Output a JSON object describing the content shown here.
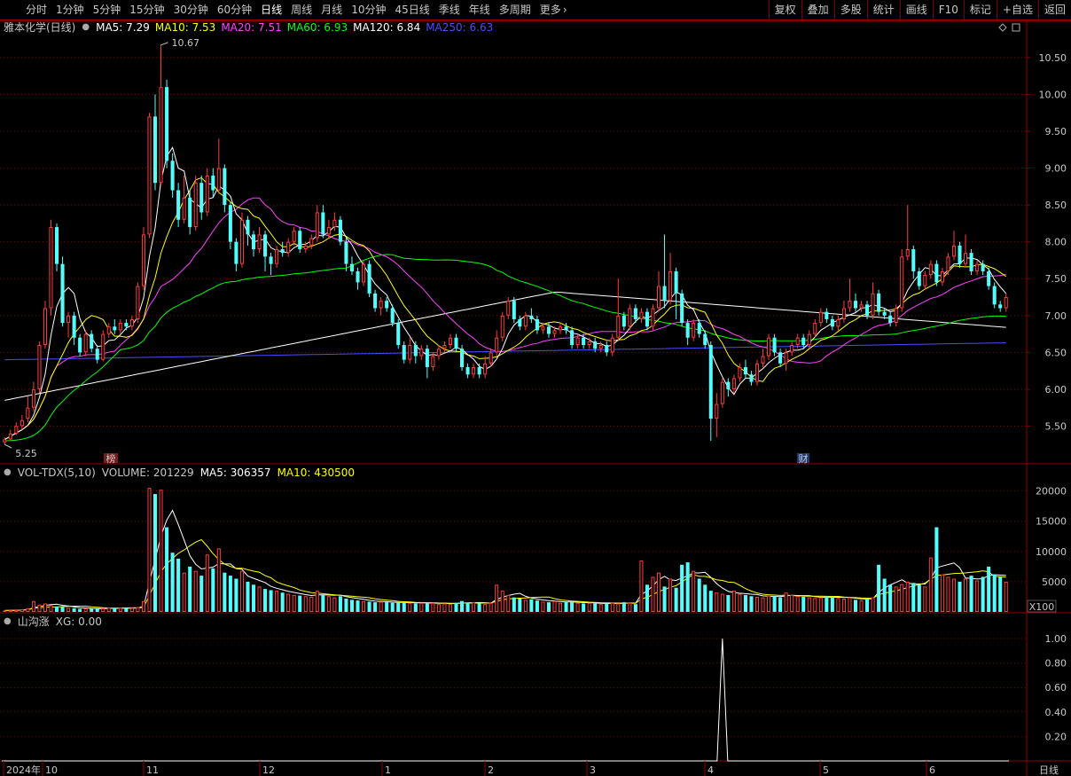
{
  "toolbar": {
    "periods": [
      "分时",
      "1分钟",
      "5分钟",
      "15分钟",
      "30分钟",
      "60分钟",
      "日线",
      "周线",
      "月线",
      "10分钟",
      "45日线",
      "季线",
      "年线",
      "多周期",
      "更多"
    ],
    "active_period": "日线",
    "more_chevron": "›",
    "actions": [
      "复权",
      "叠加",
      "多股",
      "统计",
      "画线",
      "F10",
      "标记",
      "+自选",
      "返回"
    ]
  },
  "price_panel": {
    "stock_name": "雅本化学(日线)",
    "indicators": [
      {
        "label": "MA5: 7.29",
        "color": "#ffffff"
      },
      {
        "label": "MA10: 7.53",
        "color": "#ffff00"
      },
      {
        "label": "MA20: 7.51",
        "color": "#ff40ff"
      },
      {
        "label": "MA60: 6.93",
        "color": "#00ff00"
      },
      {
        "label": "MA120: 6.84",
        "color": "#ffffff"
      },
      {
        "label": "MA250: 6.63",
        "color": "#4b4bff"
      }
    ],
    "high_label": "10.67",
    "low_label": "5.25",
    "y_ticks": [
      "10.50",
      "10.00",
      "9.50",
      "9.00",
      "8.50",
      "8.00",
      "7.50",
      "7.00",
      "6.50",
      "6.00",
      "5.50"
    ],
    "marker_bang": "榜",
    "marker_cai": "财"
  },
  "volume_panel": {
    "title": "VOL-TDX(5,10)",
    "volume": "VOLUME: 201229",
    "ma5": "MA5: 306357",
    "ma10": "MA10: 430500",
    "y_ticks": [
      "20000",
      "15000",
      "10000",
      "5000"
    ],
    "unit": "X100"
  },
  "indicator_panel": {
    "title": "山沟涨",
    "value": "XG: 0.00",
    "y_ticks": [
      "1.00",
      "0.80",
      "0.60",
      "0.40",
      "0.20"
    ]
  },
  "x_axis": {
    "labels": [
      "2024年",
      "10",
      "11",
      "12",
      "1",
      "2",
      "3",
      "4",
      "5",
      "6"
    ],
    "period": "日线"
  },
  "colors": {
    "up": "#ff3c3c",
    "down": "#54fcfc",
    "grid": "#8b0000",
    "ma5": "#ffffff",
    "ma10": "#ffff00",
    "ma20": "#ff40ff",
    "ma60": "#00ff00",
    "ma120": "#ffffff",
    "ma250": "#4b4bff"
  },
  "chart_data": {
    "type": "candlestick",
    "title": "雅本化学(日线)",
    "price_range": [
      5.0,
      10.8
    ],
    "high": 10.67,
    "low": 5.25,
    "candles": [
      {
        "o": 5.28,
        "c": 5.32,
        "h": 5.35,
        "l": 5.25
      },
      {
        "o": 5.32,
        "c": 5.4,
        "h": 5.45,
        "l": 5.3
      },
      {
        "o": 5.4,
        "c": 5.5,
        "h": 5.55,
        "l": 5.38
      },
      {
        "o": 5.5,
        "c": 5.58,
        "h": 5.65,
        "l": 5.45
      },
      {
        "o": 5.6,
        "c": 5.75,
        "h": 5.9,
        "l": 5.55
      },
      {
        "o": 5.75,
        "c": 6.0,
        "h": 6.1,
        "l": 5.7
      },
      {
        "o": 6.0,
        "c": 6.6,
        "h": 6.65,
        "l": 5.95
      },
      {
        "o": 6.6,
        "c": 7.1,
        "h": 7.2,
        "l": 6.55
      },
      {
        "o": 7.1,
        "c": 8.2,
        "h": 8.3,
        "l": 7.0
      },
      {
        "o": 8.2,
        "c": 7.7,
        "h": 8.25,
        "l": 7.6
      },
      {
        "o": 7.7,
        "c": 6.9,
        "h": 7.8,
        "l": 6.85
      },
      {
        "o": 6.9,
        "c": 7.0,
        "h": 7.05,
        "l": 6.7
      },
      {
        "o": 7.0,
        "c": 6.7,
        "h": 7.05,
        "l": 6.6
      },
      {
        "o": 6.7,
        "c": 6.5,
        "h": 6.75,
        "l": 6.45
      },
      {
        "o": 6.5,
        "c": 6.75,
        "h": 6.8,
        "l": 6.45
      },
      {
        "o": 6.75,
        "c": 6.55,
        "h": 6.8,
        "l": 6.5
      },
      {
        "o": 6.55,
        "c": 6.4,
        "h": 6.6,
        "l": 6.35
      },
      {
        "o": 6.4,
        "c": 6.75,
        "h": 6.8,
        "l": 6.38
      },
      {
        "o": 6.75,
        "c": 6.85,
        "h": 6.9,
        "l": 6.7
      },
      {
        "o": 6.85,
        "c": 6.8,
        "h": 6.95,
        "l": 6.75
      },
      {
        "o": 6.8,
        "c": 6.9,
        "h": 6.95,
        "l": 6.75
      },
      {
        "o": 6.9,
        "c": 6.85,
        "h": 6.95,
        "l": 6.8
      },
      {
        "o": 6.85,
        "c": 6.95,
        "h": 7.0,
        "l": 6.8
      },
      {
        "o": 6.95,
        "c": 7.4,
        "h": 7.45,
        "l": 6.9
      },
      {
        "o": 7.4,
        "c": 8.1,
        "h": 8.2,
        "l": 7.35
      },
      {
        "o": 8.1,
        "c": 9.7,
        "h": 9.75,
        "l": 8.05
      },
      {
        "o": 9.7,
        "c": 8.8,
        "h": 10.0,
        "l": 8.7
      },
      {
        "o": 8.8,
        "c": 10.1,
        "h": 10.67,
        "l": 8.75
      },
      {
        "o": 10.1,
        "c": 9.1,
        "h": 10.2,
        "l": 9.0
      },
      {
        "o": 9.1,
        "c": 8.7,
        "h": 9.2,
        "l": 8.6
      },
      {
        "o": 8.7,
        "c": 8.3,
        "h": 8.8,
        "l": 8.2
      },
      {
        "o": 8.3,
        "c": 8.6,
        "h": 8.9,
        "l": 8.25
      },
      {
        "o": 8.6,
        "c": 8.2,
        "h": 8.7,
        "l": 8.1
      },
      {
        "o": 8.2,
        "c": 8.8,
        "h": 8.9,
        "l": 8.15
      },
      {
        "o": 8.8,
        "c": 8.4,
        "h": 8.9,
        "l": 8.3
      },
      {
        "o": 8.4,
        "c": 8.9,
        "h": 9.0,
        "l": 8.35
      },
      {
        "o": 8.9,
        "c": 8.7,
        "h": 9.0,
        "l": 8.6
      },
      {
        "o": 8.7,
        "c": 9.0,
        "h": 9.4,
        "l": 8.65
      },
      {
        "o": 9.0,
        "c": 8.5,
        "h": 9.05,
        "l": 8.4
      },
      {
        "o": 8.5,
        "c": 8.0,
        "h": 8.55,
        "l": 7.9
      },
      {
        "o": 8.0,
        "c": 7.7,
        "h": 8.05,
        "l": 7.6
      },
      {
        "o": 7.7,
        "c": 8.3,
        "h": 8.4,
        "l": 7.65
      },
      {
        "o": 8.3,
        "c": 8.1,
        "h": 8.35,
        "l": 7.95
      },
      {
        "o": 8.1,
        "c": 7.9,
        "h": 8.15,
        "l": 7.8
      },
      {
        "o": 7.9,
        "c": 8.1,
        "h": 8.2,
        "l": 7.85
      },
      {
        "o": 8.1,
        "c": 7.8,
        "h": 8.15,
        "l": 7.6
      },
      {
        "o": 7.8,
        "c": 7.7,
        "h": 7.85,
        "l": 7.55
      },
      {
        "o": 7.7,
        "c": 7.9,
        "h": 7.95,
        "l": 7.65
      },
      {
        "o": 7.9,
        "c": 7.85,
        "h": 8.0,
        "l": 7.8
      },
      {
        "o": 7.85,
        "c": 8.0,
        "h": 8.05,
        "l": 7.8
      },
      {
        "o": 8.0,
        "c": 8.15,
        "h": 8.2,
        "l": 7.95
      },
      {
        "o": 8.15,
        "c": 7.9,
        "h": 8.2,
        "l": 7.85
      },
      {
        "o": 7.9,
        "c": 7.95,
        "h": 8.0,
        "l": 7.85
      },
      {
        "o": 7.95,
        "c": 8.05,
        "h": 8.1,
        "l": 7.9
      },
      {
        "o": 8.05,
        "c": 8.4,
        "h": 8.5,
        "l": 8.0
      },
      {
        "o": 8.4,
        "c": 8.1,
        "h": 8.5,
        "l": 8.05
      },
      {
        "o": 8.1,
        "c": 8.2,
        "h": 8.3,
        "l": 8.05
      },
      {
        "o": 8.2,
        "c": 8.3,
        "h": 8.4,
        "l": 8.15
      },
      {
        "o": 8.3,
        "c": 8.0,
        "h": 8.35,
        "l": 7.95
      },
      {
        "o": 8.0,
        "c": 7.7,
        "h": 8.05,
        "l": 7.6
      },
      {
        "o": 7.7,
        "c": 7.6,
        "h": 7.8,
        "l": 7.55
      },
      {
        "o": 7.6,
        "c": 7.45,
        "h": 7.65,
        "l": 7.35
      },
      {
        "o": 7.45,
        "c": 7.7,
        "h": 7.75,
        "l": 7.4
      },
      {
        "o": 7.7,
        "c": 7.3,
        "h": 7.75,
        "l": 7.25
      },
      {
        "o": 7.3,
        "c": 7.1,
        "h": 7.35,
        "l": 7.05
      },
      {
        "o": 7.1,
        "c": 7.2,
        "h": 7.25,
        "l": 7.0
      },
      {
        "o": 7.2,
        "c": 7.1,
        "h": 7.25,
        "l": 7.05
      },
      {
        "o": 7.1,
        "c": 6.9,
        "h": 7.15,
        "l": 6.85
      },
      {
        "o": 6.9,
        "c": 6.6,
        "h": 6.95,
        "l": 6.55
      },
      {
        "o": 6.6,
        "c": 6.4,
        "h": 6.65,
        "l": 6.35
      },
      {
        "o": 6.4,
        "c": 6.6,
        "h": 6.7,
        "l": 6.35
      },
      {
        "o": 6.6,
        "c": 6.45,
        "h": 6.65,
        "l": 6.35
      },
      {
        "o": 6.45,
        "c": 6.55,
        "h": 6.6,
        "l": 6.4
      },
      {
        "o": 6.55,
        "c": 6.3,
        "h": 6.6,
        "l": 6.15
      },
      {
        "o": 6.3,
        "c": 6.45,
        "h": 6.5,
        "l": 6.25
      },
      {
        "o": 6.45,
        "c": 6.55,
        "h": 6.6,
        "l": 6.4
      },
      {
        "o": 6.55,
        "c": 6.6,
        "h": 6.65,
        "l": 6.5
      },
      {
        "o": 6.6,
        "c": 6.7,
        "h": 6.75,
        "l": 6.55
      },
      {
        "o": 6.7,
        "c": 6.55,
        "h": 6.75,
        "l": 6.5
      },
      {
        "o": 6.55,
        "c": 6.3,
        "h": 6.6,
        "l": 6.25
      },
      {
        "o": 6.3,
        "c": 6.2,
        "h": 6.35,
        "l": 6.15
      },
      {
        "o": 6.2,
        "c": 6.3,
        "h": 6.35,
        "l": 6.15
      },
      {
        "o": 6.3,
        "c": 6.2,
        "h": 6.35,
        "l": 6.15
      },
      {
        "o": 6.2,
        "c": 6.35,
        "h": 6.45,
        "l": 6.15
      },
      {
        "o": 6.35,
        "c": 6.5,
        "h": 6.55,
        "l": 6.3
      },
      {
        "o": 6.5,
        "c": 6.7,
        "h": 6.8,
        "l": 6.45
      },
      {
        "o": 6.7,
        "c": 7.0,
        "h": 7.05,
        "l": 6.65
      },
      {
        "o": 7.0,
        "c": 7.2,
        "h": 7.25,
        "l": 6.95
      },
      {
        "o": 7.2,
        "c": 6.95,
        "h": 7.25,
        "l": 6.9
      },
      {
        "o": 6.95,
        "c": 6.85,
        "h": 7.0,
        "l": 6.8
      },
      {
        "o": 6.85,
        "c": 7.0,
        "h": 7.05,
        "l": 6.8
      },
      {
        "o": 7.0,
        "c": 6.95,
        "h": 7.1,
        "l": 6.9
      },
      {
        "o": 6.95,
        "c": 6.8,
        "h": 7.0,
        "l": 6.75
      },
      {
        "o": 6.8,
        "c": 6.85,
        "h": 6.9,
        "l": 6.75
      },
      {
        "o": 6.85,
        "c": 6.75,
        "h": 6.9,
        "l": 6.7
      },
      {
        "o": 6.75,
        "c": 6.8,
        "h": 6.85,
        "l": 6.7
      },
      {
        "o": 6.8,
        "c": 6.85,
        "h": 6.9,
        "l": 6.75
      },
      {
        "o": 6.85,
        "c": 6.8,
        "h": 6.9,
        "l": 6.75
      },
      {
        "o": 6.8,
        "c": 6.6,
        "h": 6.85,
        "l": 6.55
      },
      {
        "o": 6.6,
        "c": 6.7,
        "h": 6.75,
        "l": 6.55
      },
      {
        "o": 6.7,
        "c": 6.6,
        "h": 6.75,
        "l": 6.55
      },
      {
        "o": 6.6,
        "c": 6.65,
        "h": 6.7,
        "l": 6.55
      },
      {
        "o": 6.65,
        "c": 6.55,
        "h": 6.7,
        "l": 6.5
      },
      {
        "o": 6.55,
        "c": 6.6,
        "h": 6.65,
        "l": 6.5
      },
      {
        "o": 6.6,
        "c": 6.5,
        "h": 6.65,
        "l": 6.45
      },
      {
        "o": 6.5,
        "c": 6.7,
        "h": 6.75,
        "l": 6.45
      },
      {
        "o": 6.7,
        "c": 7.0,
        "h": 7.5,
        "l": 6.65
      },
      {
        "o": 7.0,
        "c": 6.85,
        "h": 7.05,
        "l": 6.8
      },
      {
        "o": 6.85,
        "c": 7.1,
        "h": 7.15,
        "l": 6.8
      },
      {
        "o": 7.1,
        "c": 6.95,
        "h": 7.15,
        "l": 6.9
      },
      {
        "o": 6.95,
        "c": 7.05,
        "h": 7.1,
        "l": 6.9
      },
      {
        "o": 7.05,
        "c": 6.85,
        "h": 7.1,
        "l": 6.8
      },
      {
        "o": 6.85,
        "c": 7.1,
        "h": 7.15,
        "l": 6.8
      },
      {
        "o": 7.1,
        "c": 7.4,
        "h": 7.6,
        "l": 7.05
      },
      {
        "o": 7.4,
        "c": 7.2,
        "h": 8.1,
        "l": 7.1
      },
      {
        "o": 7.2,
        "c": 7.6,
        "h": 7.85,
        "l": 7.15
      },
      {
        "o": 7.6,
        "c": 7.3,
        "h": 7.65,
        "l": 6.95
      },
      {
        "o": 7.3,
        "c": 6.9,
        "h": 7.35,
        "l": 6.85
      },
      {
        "o": 6.9,
        "c": 6.7,
        "h": 6.95,
        "l": 6.6
      },
      {
        "o": 6.7,
        "c": 6.9,
        "h": 6.95,
        "l": 6.65
      },
      {
        "o": 6.9,
        "c": 6.75,
        "h": 6.95,
        "l": 6.7
      },
      {
        "o": 6.75,
        "c": 6.6,
        "h": 6.8,
        "l": 6.55
      },
      {
        "o": 6.6,
        "c": 5.6,
        "h": 6.65,
        "l": 5.3
      },
      {
        "o": 5.6,
        "c": 5.8,
        "h": 5.95,
        "l": 5.35
      },
      {
        "o": 5.8,
        "c": 6.1,
        "h": 6.15,
        "l": 5.75
      },
      {
        "o": 6.1,
        "c": 6.0,
        "h": 6.15,
        "l": 5.9
      },
      {
        "o": 6.0,
        "c": 6.15,
        "h": 6.2,
        "l": 5.95
      },
      {
        "o": 6.15,
        "c": 6.3,
        "h": 6.35,
        "l": 6.1
      },
      {
        "o": 6.3,
        "c": 6.2,
        "h": 6.4,
        "l": 6.15
      },
      {
        "o": 6.2,
        "c": 6.1,
        "h": 6.25,
        "l": 6.05
      },
      {
        "o": 6.1,
        "c": 6.35,
        "h": 6.4,
        "l": 6.05
      },
      {
        "o": 6.35,
        "c": 6.45,
        "h": 6.55,
        "l": 6.3
      },
      {
        "o": 6.45,
        "c": 6.7,
        "h": 6.75,
        "l": 6.4
      },
      {
        "o": 6.7,
        "c": 6.5,
        "h": 6.75,
        "l": 6.45
      },
      {
        "o": 6.5,
        "c": 6.35,
        "h": 6.55,
        "l": 6.3
      },
      {
        "o": 6.35,
        "c": 6.5,
        "h": 6.55,
        "l": 6.25
      },
      {
        "o": 6.5,
        "c": 6.6,
        "h": 6.65,
        "l": 6.45
      },
      {
        "o": 6.6,
        "c": 6.7,
        "h": 6.75,
        "l": 6.55
      },
      {
        "o": 6.7,
        "c": 6.6,
        "h": 6.75,
        "l": 6.55
      },
      {
        "o": 6.6,
        "c": 6.75,
        "h": 6.8,
        "l": 6.55
      },
      {
        "o": 6.75,
        "c": 6.9,
        "h": 6.95,
        "l": 6.7
      },
      {
        "o": 6.9,
        "c": 7.05,
        "h": 7.1,
        "l": 6.85
      },
      {
        "o": 7.05,
        "c": 6.95,
        "h": 7.1,
        "l": 6.9
      },
      {
        "o": 6.95,
        "c": 6.85,
        "h": 7.0,
        "l": 6.8
      },
      {
        "o": 6.85,
        "c": 6.95,
        "h": 7.0,
        "l": 6.8
      },
      {
        "o": 6.95,
        "c": 7.1,
        "h": 7.2,
        "l": 6.9
      },
      {
        "o": 7.1,
        "c": 7.2,
        "h": 7.5,
        "l": 7.05
      },
      {
        "o": 7.2,
        "c": 7.1,
        "h": 7.3,
        "l": 7.05
      },
      {
        "o": 7.1,
        "c": 7.15,
        "h": 7.2,
        "l": 7.05
      },
      {
        "o": 7.15,
        "c": 7.0,
        "h": 7.2,
        "l": 6.95
      },
      {
        "o": 7.0,
        "c": 7.3,
        "h": 7.45,
        "l": 6.95
      },
      {
        "o": 7.3,
        "c": 7.05,
        "h": 7.35,
        "l": 7.0
      },
      {
        "o": 7.05,
        "c": 7.0,
        "h": 7.1,
        "l": 6.95
      },
      {
        "o": 7.0,
        "c": 6.9,
        "h": 7.05,
        "l": 6.85
      },
      {
        "o": 6.9,
        "c": 7.1,
        "h": 7.15,
        "l": 6.85
      },
      {
        "o": 7.1,
        "c": 7.8,
        "h": 7.9,
        "l": 7.05
      },
      {
        "o": 7.8,
        "c": 7.9,
        "h": 8.5,
        "l": 7.75
      },
      {
        "o": 7.9,
        "c": 7.6,
        "h": 7.95,
        "l": 7.5
      },
      {
        "o": 7.6,
        "c": 7.4,
        "h": 7.65,
        "l": 7.35
      },
      {
        "o": 7.4,
        "c": 7.55,
        "h": 7.6,
        "l": 7.35
      },
      {
        "o": 7.55,
        "c": 7.7,
        "h": 7.75,
        "l": 7.5
      },
      {
        "o": 7.7,
        "c": 7.45,
        "h": 7.75,
        "l": 7.4
      },
      {
        "o": 7.45,
        "c": 7.6,
        "h": 7.65,
        "l": 7.4
      },
      {
        "o": 7.6,
        "c": 7.8,
        "h": 7.85,
        "l": 7.55
      },
      {
        "o": 7.8,
        "c": 7.95,
        "h": 8.15,
        "l": 7.75
      },
      {
        "o": 7.95,
        "c": 7.7,
        "h": 8.0,
        "l": 7.65
      },
      {
        "o": 7.7,
        "c": 7.85,
        "h": 8.1,
        "l": 7.65
      },
      {
        "o": 7.85,
        "c": 7.6,
        "h": 7.9,
        "l": 7.55
      },
      {
        "o": 7.6,
        "c": 7.7,
        "h": 7.75,
        "l": 7.55
      },
      {
        "o": 7.7,
        "c": 7.6,
        "h": 7.75,
        "l": 7.55
      },
      {
        "o": 7.6,
        "c": 7.4,
        "h": 7.65,
        "l": 7.35
      },
      {
        "o": 7.4,
        "c": 7.15,
        "h": 7.45,
        "l": 7.1
      },
      {
        "o": 7.15,
        "c": 7.1,
        "h": 7.2,
        "l": 7.05
      },
      {
        "o": 7.1,
        "c": 7.25,
        "h": 7.3,
        "l": 7.05
      }
    ],
    "volume": [
      230,
      280,
      300,
      420,
      600,
      1800,
      1200,
      1400,
      1100,
      900,
      800,
      700,
      600,
      500,
      600,
      550,
      520,
      600,
      700,
      650,
      700,
      650,
      680,
      800,
      1800,
      20500,
      19500,
      20200,
      14000,
      9800,
      8800,
      6500,
      7500,
      6800,
      6000,
      9500,
      7200,
      10500,
      6500,
      6000,
      5500,
      6800,
      5000,
      4500,
      4200,
      3800,
      3600,
      3500,
      3200,
      3000,
      2800,
      2700,
      2600,
      2500,
      3500,
      2800,
      2600,
      2400,
      2600,
      2200,
      2000,
      1900,
      1800,
      1700,
      1600,
      1700,
      1600,
      1500,
      1500,
      1600,
      1500,
      1400,
      1500,
      1400,
      1500,
      1300,
      1400,
      1300,
      1500,
      1800,
      1500,
      1600,
      1400,
      1300,
      1500,
      4500,
      3500,
      2800,
      2400,
      2200,
      2000,
      2100,
      1900,
      1700,
      1600,
      1800,
      1500,
      1700,
      1600,
      1500,
      1400,
      1500,
      1400,
      1300,
      1400,
      1500,
      1400,
      1600,
      1500,
      1300,
      8500,
      4500,
      5800,
      6500,
      4200,
      5500,
      4000,
      7800,
      8200,
      6800,
      5500,
      4500,
      3500,
      3200,
      3000,
      2800,
      3500,
      3000,
      2800,
      2600,
      2500,
      2400,
      2700,
      2600,
      2400,
      3200,
      2800,
      2600,
      2500,
      2400,
      2300,
      2400,
      2600,
      2500,
      2300,
      2200,
      2400,
      2000,
      1900,
      2200,
      2400,
      7800,
      5500,
      4500,
      4200,
      4600,
      5000,
      4800,
      4500,
      4200,
      9000,
      14000,
      6200,
      5800,
      5500,
      5000,
      5500,
      6000,
      5200,
      5800,
      7500,
      6200,
      5800,
      5000,
      4800,
      4500,
      3800,
      2200
    ]
  }
}
